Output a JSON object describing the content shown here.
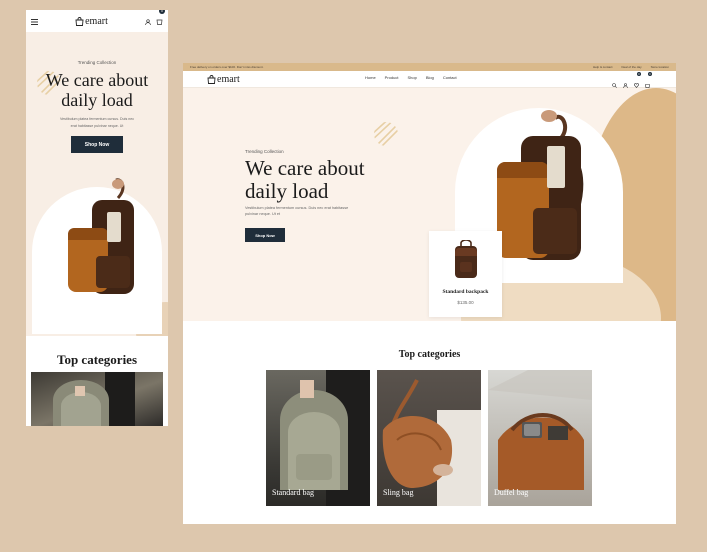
{
  "brand": "emart",
  "mobile": {
    "cart_count": "0",
    "hero": {
      "eyebrow": "Trending Collection",
      "title_line1": "We care about",
      "title_line2": "daily load",
      "description_line1": "Vestibulum platea fermentum cursus. Duis nec",
      "description_line2": "erat habitasse pulvinar neque. Ut",
      "cta": "Shop Now"
    },
    "categories_title": "Top categories"
  },
  "desktop": {
    "topbar": {
      "promo": "Free delivery on orders over $100. Don't miss discount.",
      "help": "Help & contact",
      "deal": "Deal of the day",
      "store": "Store location"
    },
    "nav": [
      "Home",
      "Product",
      "Shop",
      "Blog",
      "Contact"
    ],
    "wishlist_count": "0",
    "cart_count": "0",
    "hero": {
      "eyebrow": "Trending Collection",
      "title_line1": "We care about",
      "title_line2": "daily load",
      "description_line1": "Vestibulum platea fermentum cursus. Duis nec erat habitasse",
      "description_line2": "pulvinar neque. Ut et",
      "cta": "Shop Now"
    },
    "product_card": {
      "name": "Standard backpack",
      "price": "$135.00"
    },
    "categories_title": "Top categories",
    "categories": [
      "Standard bag",
      "Sling bag",
      "Duffel bag"
    ]
  },
  "colors": {
    "background": "#ddc7ad",
    "accent": "#d9b98b",
    "button": "#1f2d3a",
    "hero_bg": "#fbf2ea"
  }
}
